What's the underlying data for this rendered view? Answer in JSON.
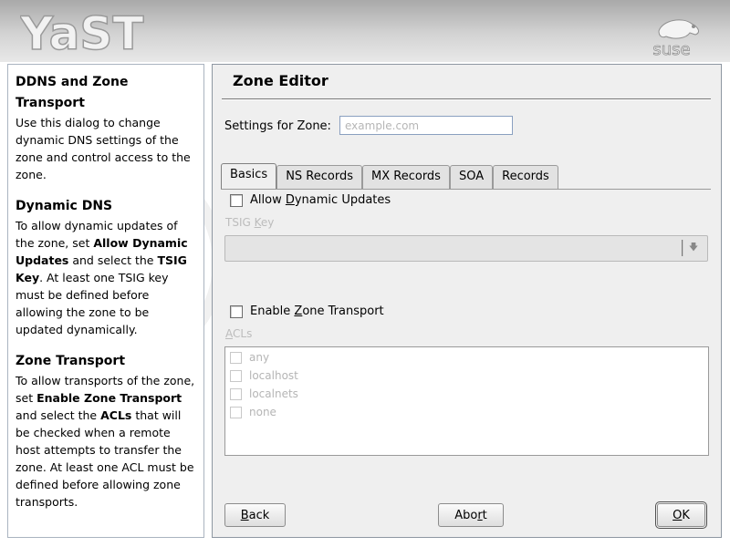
{
  "header": {
    "logo_text": "YaST",
    "brand_logo_text": "suse"
  },
  "help": {
    "sections": [
      {
        "heading": "DDNS and Zone Transport",
        "text": "Use this dialog to change dynamic DNS settings of the zone and control access to the zone."
      },
      {
        "heading": "Dynamic DNS",
        "text_parts": [
          "To allow dynamic updates of the zone, set ",
          "Allow Dynamic Updates",
          " and select the ",
          "TSIG Key",
          ". At least one TSIG key must be defined before allowing the zone to be updated dynamically."
        ]
      },
      {
        "heading": "Zone Transport",
        "text_parts": [
          "To allow transports of the zone, set ",
          "Enable Zone Transport",
          " and select the ",
          "ACLs",
          " that will be checked when a remote host attempts to transfer the zone. At least one ACL must be defined before allowing zone transports."
        ]
      }
    ]
  },
  "dialog": {
    "title": "Zone Editor",
    "zone_label": "Settings for Zone:",
    "zone_placeholder": "example.com",
    "zone_value": "",
    "tabs": [
      "Basics",
      "NS Records",
      "MX Records",
      "SOA",
      "Records"
    ],
    "active_tab": "Basics",
    "allow_dynamic": {
      "label_pre": "Allow ",
      "label_u": "D",
      "label_post": "ynamic Updates",
      "checked": false
    },
    "tsig": {
      "label_pre": "TSIG ",
      "label_u": "K",
      "label_post": "ey",
      "value": ""
    },
    "zone_transport": {
      "label_pre": "Enable ",
      "label_u": "Z",
      "label_post": "one Transport",
      "checked": false
    },
    "acls": {
      "label_u": "A",
      "label_post": "CLs",
      "items": [
        "any",
        "localhost",
        "localnets",
        "none"
      ]
    },
    "buttons": {
      "back": {
        "u": "B",
        "rest": "ack"
      },
      "abort": {
        "pre": "Abo",
        "u": "r",
        "rest": "t"
      },
      "ok": {
        "u": "O",
        "rest": "K"
      }
    }
  },
  "colors": {
    "header_gradient_top": "#a9a9a9",
    "panel_border": "#8e97a2",
    "disabled_text": "#bcbcbc"
  }
}
